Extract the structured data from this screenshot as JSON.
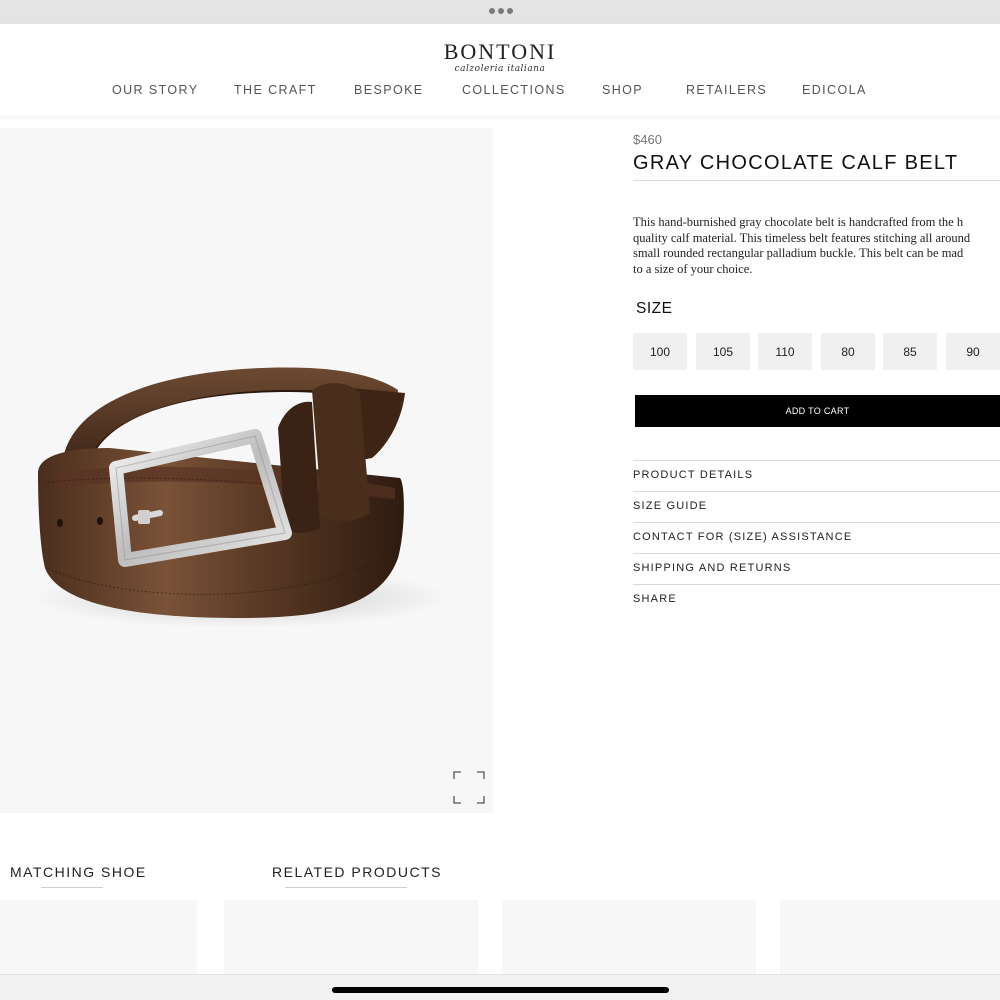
{
  "header": {
    "logo": {
      "name": "BONTONI",
      "tagline": "calzoleria italiana"
    },
    "nav": [
      {
        "label": "OUR STORY"
      },
      {
        "label": "THE CRAFT"
      },
      {
        "label": "BESPOKE"
      },
      {
        "label": "COLLECTIONS"
      },
      {
        "label": "SHOP"
      },
      {
        "label": "RETAILERS"
      },
      {
        "label": "EDICOLA"
      }
    ]
  },
  "product": {
    "price": "$460",
    "title": "GRAY CHOCOLATE CALF BELT",
    "description_lines": [
      "This hand-burnished gray chocolate belt is handcrafted from the h",
      "quality calf material. This timeless belt features stitching all around",
      "small rounded rectangular palladium buckle.  This belt can be mad",
      "to a size of your choice."
    ],
    "size_label": "SIZE",
    "sizes": [
      "100",
      "105",
      "110",
      "80",
      "85",
      "90"
    ],
    "add_to_cart": "ADD TO CART",
    "accordion": [
      {
        "label": "PRODUCT DETAILS"
      },
      {
        "label": "SIZE GUIDE"
      },
      {
        "label": "CONTACT FOR (SIZE) ASSISTANCE"
      },
      {
        "label": "SHIPPING AND RETURNS"
      },
      {
        "label": "SHARE"
      }
    ],
    "image_icon": "belt-illustration",
    "expand_icon": "expand-icon"
  },
  "bottom": {
    "matching_title": "MATCHING SHOE",
    "related_title": "RELATED PRODUCTS"
  },
  "colors": {
    "accent": "#000000",
    "leather_dark": "#3b2416",
    "leather_mid": "#6b4a33",
    "buckle": "#cfcfcf"
  }
}
